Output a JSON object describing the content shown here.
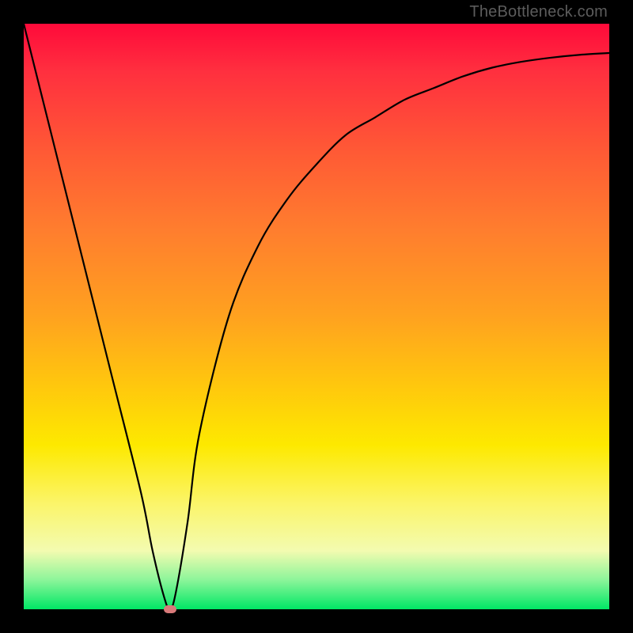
{
  "watermark": "TheBottleneck.com",
  "chart_data": {
    "type": "line",
    "title": "",
    "xlabel": "",
    "ylabel": "",
    "xlim": [
      0,
      100
    ],
    "ylim": [
      0,
      100
    ],
    "series": [
      {
        "name": "bottleneck-curve",
        "x": [
          0,
          5,
          10,
          15,
          20,
          22,
          24,
          25,
          26,
          28,
          30,
          35,
          40,
          45,
          50,
          55,
          60,
          65,
          70,
          75,
          80,
          85,
          90,
          95,
          100
        ],
        "values": [
          100,
          80,
          60,
          40,
          20,
          10,
          2,
          0,
          3,
          15,
          30,
          50,
          62,
          70,
          76,
          81,
          84,
          87,
          89,
          91,
          92.5,
          93.5,
          94.2,
          94.7,
          95
        ]
      }
    ],
    "annotations": [
      {
        "name": "minimum-marker",
        "x": 25,
        "y": 0
      }
    ],
    "background_gradient": {
      "top": "#ff0a3a",
      "mid1": "#ffa21f",
      "mid2": "#fde900",
      "bottom": "#00e765"
    }
  }
}
